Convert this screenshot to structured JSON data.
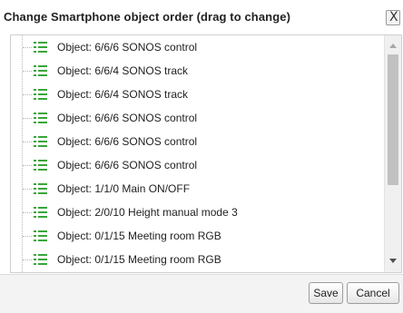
{
  "dialog": {
    "title": "Change Smartphone object order (drag to change)",
    "close_label": "X"
  },
  "list": {
    "items": [
      {
        "label": "Object: 6/6/6 SONOS control"
      },
      {
        "label": "Object: 6/6/4 SONOS track"
      },
      {
        "label": "Object: 6/6/4 SONOS track"
      },
      {
        "label": "Object: 6/6/6 SONOS control"
      },
      {
        "label": "Object: 6/6/6 SONOS control"
      },
      {
        "label": "Object: 6/6/6 SONOS control"
      },
      {
        "label": "Object: 1/1/0 Main ON/OFF"
      },
      {
        "label": "Object: 2/0/10 Height manual mode 3"
      },
      {
        "label": "Object: 0/1/15 Meeting room RGB"
      },
      {
        "label": "Object: 0/1/15 Meeting room RGB"
      },
      {
        "label": ""
      }
    ],
    "item_icon": "list-icon",
    "icon_color": "#3aa53a"
  },
  "footer": {
    "save_label": "Save",
    "cancel_label": "Cancel"
  }
}
